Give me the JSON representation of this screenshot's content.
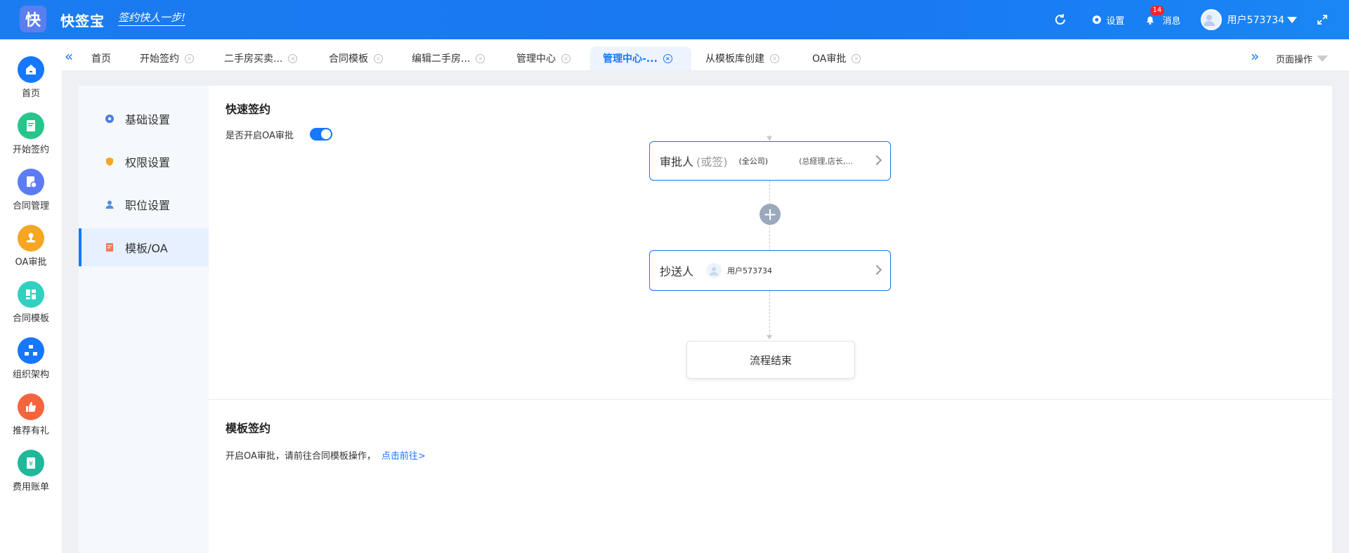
{
  "header": {
    "logo_char": "快",
    "app_name": "快签宝",
    "slogan": "签约快人一步!",
    "settings_label": "设置",
    "messages_label": "消息",
    "messages_badge": "14",
    "user_name": "用户573734"
  },
  "sidebar": {
    "items": [
      {
        "label": "首页",
        "icon": "home-icon",
        "color": "#1677ff"
      },
      {
        "label": "开始签约",
        "icon": "sign-doc-icon",
        "color": "#26c68b"
      },
      {
        "label": "合同管理",
        "icon": "contract-manage-icon",
        "color": "#5b7cf5"
      },
      {
        "label": "OA审批",
        "icon": "stamp-icon",
        "color": "#f5a623"
      },
      {
        "label": "合同模板",
        "icon": "template-icon",
        "color": "#2fd1c1"
      },
      {
        "label": "组织架构",
        "icon": "org-icon",
        "color": "#1677ff"
      },
      {
        "label": "推荐有礼",
        "icon": "thumbs-up-icon",
        "color": "#f5643c"
      },
      {
        "label": "费用账单",
        "icon": "bill-icon",
        "color": "#20b89a"
      }
    ]
  },
  "tabs": {
    "items": [
      {
        "label": "首页",
        "closable": false
      },
      {
        "label": "开始签约",
        "closable": true
      },
      {
        "label": "二手房买卖...",
        "closable": true
      },
      {
        "label": "合同模板",
        "closable": true
      },
      {
        "label": "编辑二手房...",
        "closable": true
      },
      {
        "label": "管理中心",
        "closable": true
      },
      {
        "label": "管理中心-...",
        "closable": true,
        "active": true
      },
      {
        "label": "从模板库创建",
        "closable": true
      },
      {
        "label": "OA审批",
        "closable": true
      }
    ],
    "page_ops_label": "页面操作"
  },
  "subnav": {
    "items": [
      {
        "label": "基础设置",
        "icon": "gear-icon"
      },
      {
        "label": "权限设置",
        "icon": "shield-icon"
      },
      {
        "label": "职位设置",
        "icon": "person-icon"
      },
      {
        "label": "模板/OA",
        "icon": "template-doc-icon",
        "active": true
      }
    ]
  },
  "quick_sign": {
    "title": "快速签约",
    "toggle_label": "是否开启OA审批",
    "toggle_on": true,
    "approver": {
      "title": "审批人",
      "mode": "(或签)",
      "scope": "(全公司)",
      "roles": "(总経理,店长,..."
    },
    "cc": {
      "title": "抄送人",
      "user": "用户573734"
    },
    "end_label": "流程结束"
  },
  "template_sign": {
    "title": "模板签约",
    "text": "开启OA审批，请前往合同模板操作，",
    "link": "点击前往>"
  }
}
